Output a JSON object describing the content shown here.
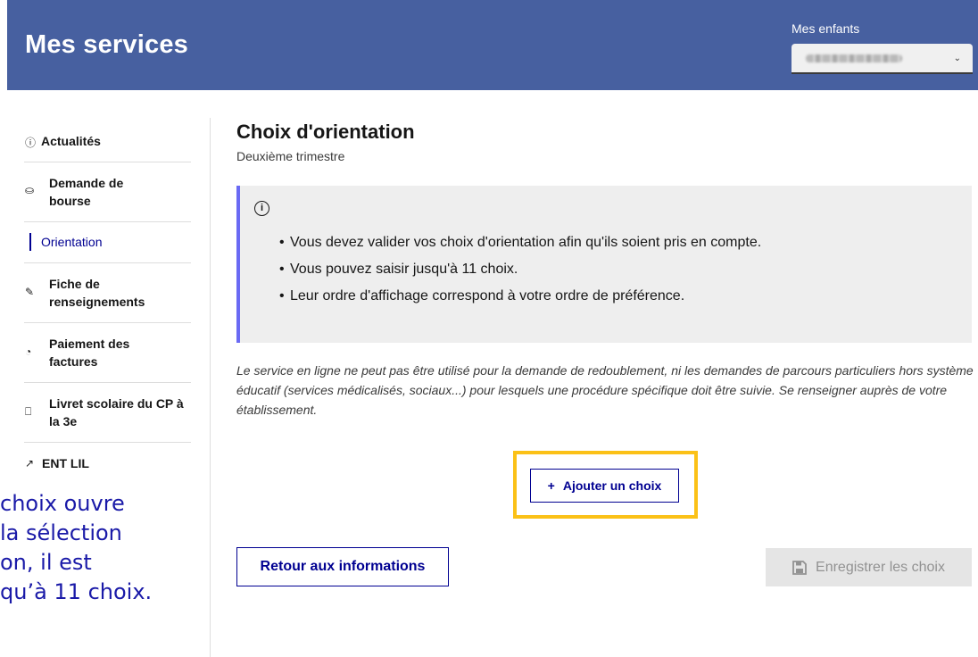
{
  "header": {
    "title": "Mes services",
    "child_label": "Mes enfants",
    "child_chevron": "⌄"
  },
  "sidebar": {
    "items": [
      {
        "label": "Actualités",
        "icon": "ⓘ",
        "icon_name": "info-icon"
      },
      {
        "label": "Demande de bourse",
        "icon": "⛀",
        "icon_name": "hand-coins-icon"
      },
      {
        "label": "Orientation",
        "icon": "",
        "icon_name": ""
      },
      {
        "label": "Fiche de renseignements",
        "icon": "✎",
        "icon_name": "form-edit-icon"
      },
      {
        "label": "Paiement des factures",
        "icon": "◔",
        "icon_name": "payment-icon"
      },
      {
        "label": "Livret scolaire du CP à la 3e",
        "icon": "⎕",
        "icon_name": "book-icon"
      },
      {
        "label": "ENT LIL",
        "icon": "↗",
        "icon_name": "external-link-icon"
      }
    ]
  },
  "overlay": {
    "lines": [
      " choix  ouvre",
      " la sélection",
      "on, il est",
      "qu’à 11 choix."
    ]
  },
  "main": {
    "title": "Choix d'orientation",
    "subtitle": "Deuxième trimestre",
    "info_icon": "i",
    "info_items": [
      "Vous devez valider vos choix d'orientation afin qu'ils soient pris en compte.",
      "Vous pouvez saisir jusqu'à 11 choix.",
      "Leur ordre d'affichage correspond à votre ordre de préférence."
    ],
    "notice": "Le service en ligne ne peut pas être utilisé pour la demande de redoublement, ni les demandes de parcours particuliers hors système éducatif (services médicalisés, sociaux...) pour lesquels une procédure spécifique doit être suivie. Se renseigner auprès de votre établissement.",
    "add_icon": "+",
    "add_label": "Ajouter un choix",
    "back_label": "Retour aux informations",
    "save_label": "Enregistrer les choix"
  },
  "colors": {
    "header_bg": "#4760a0",
    "primary": "#000091",
    "info_border": "#6a6af4",
    "highlight": "#fbc117",
    "disabled_bg": "#e5e5e5"
  }
}
